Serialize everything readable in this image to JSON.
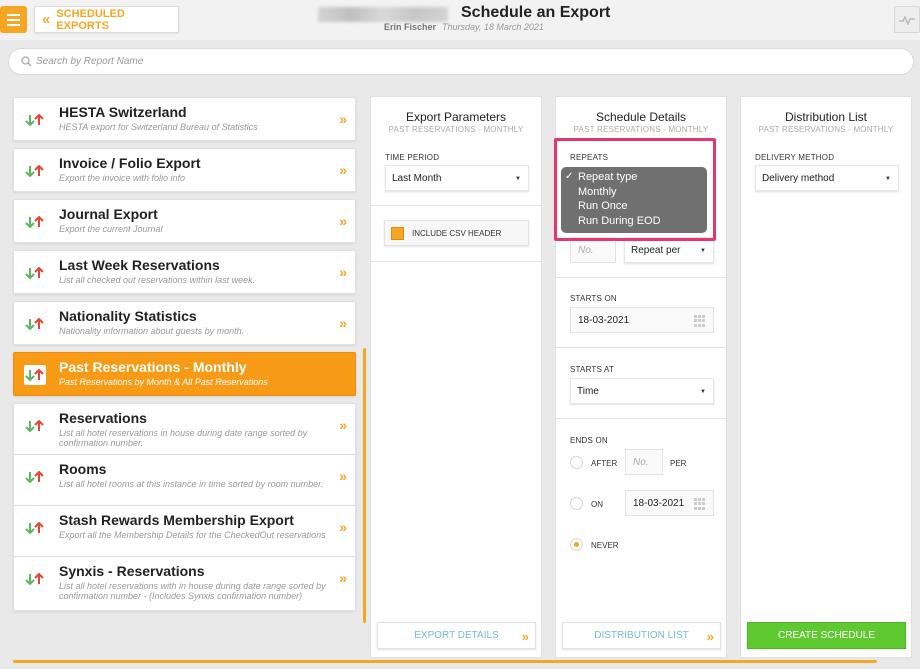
{
  "header": {
    "back_label": "SCHEDULED EXPORTS",
    "title": "Schedule an Export",
    "user": "Erin Fischer",
    "date": "Thursday, 18 March 2021"
  },
  "search": {
    "placeholder": "Search by Report Name"
  },
  "reports": [
    {
      "name": "HESTA Switzerland",
      "desc": "HESTA export for Switzerland Bureau of Statistics"
    },
    {
      "name": "Invoice / Folio Export",
      "desc": "Export the invoice with folio info"
    },
    {
      "name": "Journal Export",
      "desc": "Export the current Journal"
    },
    {
      "name": "Last Week Reservations",
      "desc": "List all checked out reservations within last week."
    },
    {
      "name": "Nationality Statistics",
      "desc": "Nationality information about guests by month."
    },
    {
      "name": "Past Reservations - Monthly",
      "desc": "Past Reservations by Month & All Past Reservations",
      "selected": true
    },
    {
      "name": "Reservations",
      "desc": "List all hotel reservations in house during date range sorted by confirmation number."
    },
    {
      "name": "Rooms",
      "desc": "List all hotel rooms at this instance in time sorted by room number."
    },
    {
      "name": "Stash Rewards Membership Export",
      "desc": "Export all the Membership Details for the CheckedOut reservations"
    },
    {
      "name": "Synxis - Reservations",
      "desc": "List all hotel reservations with in house during date range sorted by confirmation number - (Includes Synxis confirmation number)"
    }
  ],
  "export_params": {
    "title": "Export Parameters",
    "subtitle": "PAST RESERVATIONS - MONTHLY",
    "time_period_label": "TIME PERIOD",
    "time_period_value": "Last Month",
    "csv_header_label": "INCLUDE CSV HEADER",
    "footer_button": "EXPORT DETAILS"
  },
  "schedule": {
    "title": "Schedule Details",
    "subtitle": "PAST RESERVATIONS - MONTHLY",
    "repeats_label": "REPEATS",
    "repeat_options": [
      "Repeat type",
      "Monthly",
      "Run Once",
      "Run During EOD"
    ],
    "repeat_no_placeholder": "No.",
    "repeat_per": "Repeat per",
    "starts_on_label": "STARTS ON",
    "starts_on_value": "18-03-2021",
    "starts_at_label": "STARTS AT",
    "starts_at_value": "Time",
    "ends_on_label": "ENDS ON",
    "after_label": "AFTER",
    "after_placeholder": "No.",
    "per_label": "PER",
    "on_label": "ON",
    "on_value": "18-03-2021",
    "never_label": "NEVER",
    "footer_button": "DISTRIBUTION LIST"
  },
  "distribution": {
    "title": "Distribution List",
    "subtitle": "PAST RESERVATIONS - MONTHLY",
    "method_label": "DELIVERY METHOD",
    "method_value": "Delivery method",
    "footer_button": "CREATE SCHEDULE"
  },
  "colors": {
    "accent": "#f5a623",
    "highlight": "#e8366c",
    "create": "#5ec930",
    "link": "#7ab8d9"
  }
}
